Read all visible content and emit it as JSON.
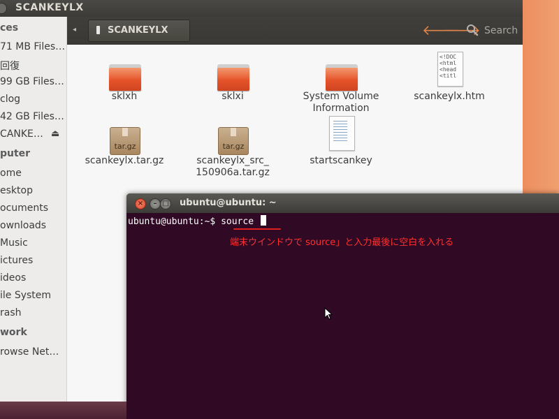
{
  "file_manager": {
    "window_title": "SCANKEYLX",
    "toolbar": {
      "path_button": "SCANKEYLX",
      "search_label": "Search"
    },
    "sidebar": {
      "items": [
        {
          "label": "ces",
          "type": "header"
        },
        {
          "label": "71 MB Files…",
          "type": "item"
        },
        {
          "label": "回復",
          "type": "item"
        },
        {
          "label": "99 GB Files…",
          "type": "item"
        },
        {
          "label": "clog",
          "type": "item"
        },
        {
          "label": "42 GB Files…",
          "type": "item"
        },
        {
          "label": "CANKE…",
          "type": "item"
        },
        {
          "label": "puter",
          "type": "header"
        },
        {
          "label": "ome",
          "type": "item"
        },
        {
          "label": "esktop",
          "type": "item"
        },
        {
          "label": "ocuments",
          "type": "item"
        },
        {
          "label": "ownloads",
          "type": "item"
        },
        {
          "label": "Music",
          "type": "item"
        },
        {
          "label": "ictures",
          "type": "item"
        },
        {
          "label": "ideos",
          "type": "item"
        },
        {
          "label": "ile System",
          "type": "item"
        },
        {
          "label": "rash",
          "type": "item"
        },
        {
          "label": "work",
          "type": "header"
        },
        {
          "label": "rowse Net…",
          "type": "item"
        }
      ]
    },
    "files": [
      {
        "name": "sklxh",
        "kind": "folder"
      },
      {
        "name": "sklxi",
        "kind": "folder"
      },
      {
        "name": "System Volume Information",
        "kind": "folder"
      },
      {
        "name": "scankeylx.htm",
        "kind": "html",
        "preview": "<!DOC\n<html\n<head\n<titl"
      },
      {
        "name": "scankeylx.tar.gz",
        "kind": "archive",
        "badge": "tar.gz"
      },
      {
        "name": "scankeylx_src_150906a.tar.gz",
        "name_line1": "scankeylx_src_",
        "name_line2": "150906a.tar.gz",
        "kind": "archive",
        "badge": "tar.gz"
      },
      {
        "name": "startscankey",
        "kind": "script"
      }
    ]
  },
  "terminal": {
    "window_title": "ubuntu@ubuntu: ~",
    "prompt": "ubuntu@ubuntu:~$ ",
    "command": "source ",
    "annotation": "端末ウインドウで source」と入力最後に空白を入れる"
  },
  "colors": {
    "terminal_bg": "#300a24",
    "annotation_red": "#ff3030",
    "folder_orange": "#e5532a",
    "nav_arrow": "#e1844a"
  }
}
